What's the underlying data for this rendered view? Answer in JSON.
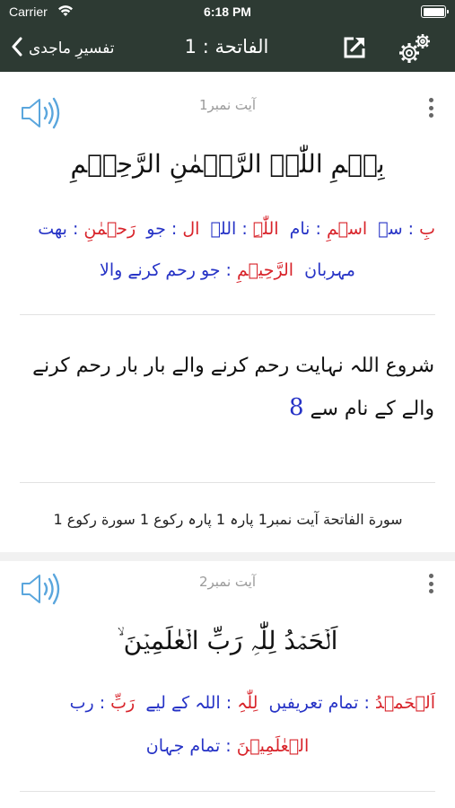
{
  "status_bar": {
    "carrier": "Carrier",
    "time": "6:18 PM",
    "wifi_icon": "wifi-icon",
    "battery_icon": "battery-icon"
  },
  "nav": {
    "back_label": "تفسیرِ ماجدی",
    "title": "الفاتحة : 1",
    "back_icon": "chevron-left-icon",
    "share_icon": "share-icon",
    "settings_icon": "gear-icon",
    "background": "#2d3a33"
  },
  "colors": {
    "arabic_word": "#d8232a",
    "urdu_meaning": "#2633c6",
    "audio_icon": "#5aa6dd"
  },
  "verses": [
    {
      "ayat_label": "آیت نمبر1",
      "arabic": "بِسۡمِ اللّٰہِ الرَّحۡمٰنِ الرَّحِیۡمِ",
      "wbw_line1": [
        {
          "ar": "بِ",
          "ur": "سے"
        },
        {
          "ar": "اسۡمِ",
          "ur": "نام"
        },
        {
          "ar": "اللّٰہِ",
          "ur": "اللہ"
        },
        {
          "ar": "ال",
          "ur": "جو"
        },
        {
          "ar": "رَحۡمٰنِ",
          "ur": "بھت"
        }
      ],
      "wbw_line2": [
        {
          "ar": "",
          "ur": "مہربان"
        },
        {
          "ar": "الرَّحِیۡمِ",
          "ur": "جو رحم کرنے والا"
        }
      ],
      "translation": "شروع اللہ نہایت رحم کرنے والے بار بار رحم کرنے والے کے نام سے",
      "footnote": "8",
      "reference": "سورة الفاتحة آیت نمبر1 پارہ 1 پارہ رکوع 1 سورة رکوع 1"
    },
    {
      "ayat_label": "آیت نمبر2",
      "arabic": "اَلۡحَمۡدُ لِلّٰہِ رَبِّ الۡعٰلَمِیۡنَ ۙ",
      "wbw_line1": [
        {
          "ar": "اَلۡحَمۡدُ",
          "ur": "تمام تعریفیں"
        },
        {
          "ar": "لِلّٰہِ",
          "ur": "اللہ کے لیے"
        },
        {
          "ar": "رَبِّ",
          "ur": "رب"
        }
      ],
      "wbw_line2": [
        {
          "ar": "الۡعٰلَمِیۡنَ",
          "ur": "تمام جہان"
        }
      ]
    }
  ]
}
